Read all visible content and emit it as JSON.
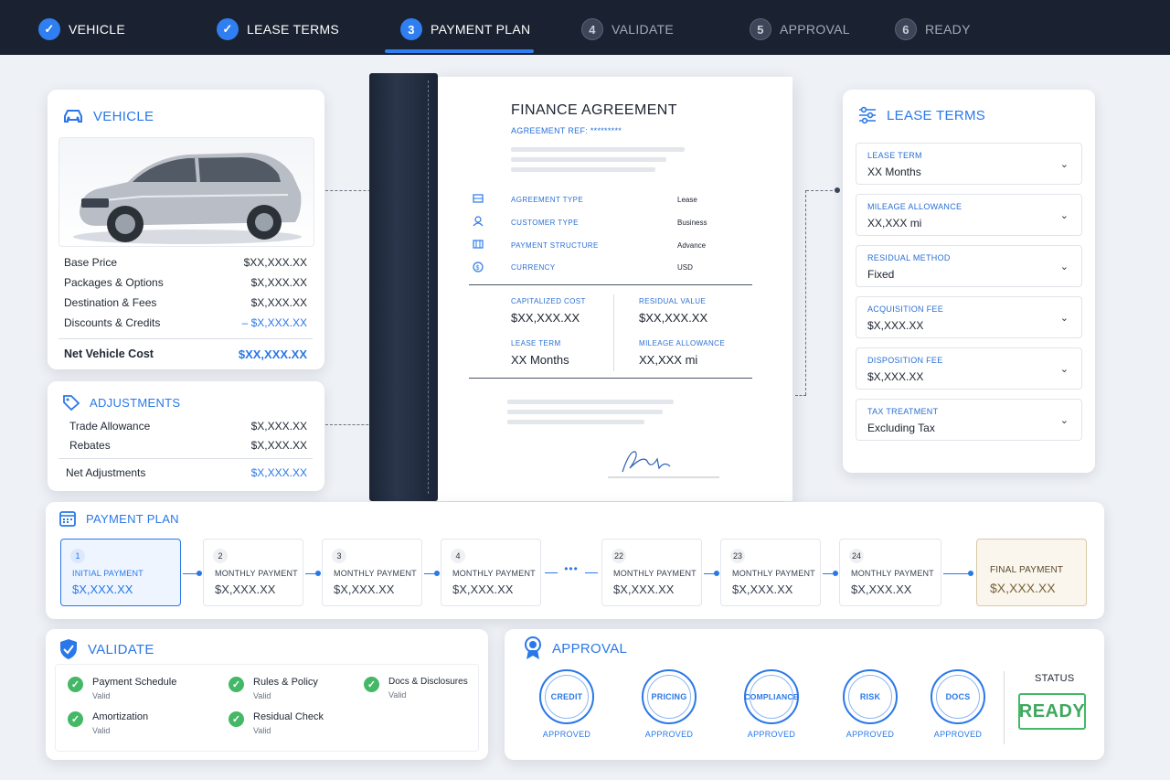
{
  "stepper": [
    {
      "num": "",
      "label": "VEHICLE",
      "state": "done"
    },
    {
      "num": "",
      "label": "LEASE TERMS",
      "state": "done"
    },
    {
      "num": "3",
      "label": "PAYMENT PLAN",
      "state": "active"
    },
    {
      "num": "4",
      "label": "VALIDATE",
      "state": "todo"
    },
    {
      "num": "5",
      "label": "APPROVAL",
      "state": "todo"
    },
    {
      "num": "6",
      "label": "READY",
      "state": "todo"
    }
  ],
  "vehicle": {
    "title": "VEHICLE",
    "rows": [
      {
        "label": "Base Price",
        "value": "$XX,XXX.XX"
      },
      {
        "label": "Packages & Options",
        "value": "$X,XXX.XX"
      },
      {
        "label": "Destination & Fees",
        "value": "$X,XXX.XX"
      },
      {
        "label": "Discounts & Credits",
        "value": "– $X,XXX.XX"
      }
    ],
    "net_label": "Net Vehicle Cost",
    "net_value": "$XX,XXX.XX"
  },
  "adjustments": {
    "title": "ADJUSTMENTS",
    "rows": [
      {
        "label": "Trade Allowance",
        "value": "$X,XXX.XX"
      },
      {
        "label": "Rebates",
        "value": "$X,XXX.XX"
      }
    ],
    "net_label": "Net Adjustments",
    "net_value": "$X,XXX.XX"
  },
  "document": {
    "title": "FINANCE AGREEMENT",
    "ref": "AGREEMENT REF: *********",
    "items": [
      {
        "label": "AGREEMENT TYPE",
        "value": "Lease"
      },
      {
        "label": "CUSTOMER TYPE",
        "value": "Business"
      },
      {
        "label": "PAYMENT STRUCTURE",
        "value": "Advance"
      },
      {
        "label": "CURRENCY",
        "value": "USD"
      }
    ],
    "grid": [
      {
        "label": "CAPITALIZED COST",
        "value": "$XX,XXX.XX"
      },
      {
        "label": "RESIDUAL VALUE",
        "value": "$XX,XXX.XX"
      },
      {
        "label": "LEASE TERM",
        "value": "XX Months"
      },
      {
        "label": "MILEAGE ALLOWANCE",
        "value": "XX,XXX mi"
      }
    ]
  },
  "lease_terms": {
    "title": "LEASE TERMS",
    "fields": [
      {
        "label": "LEASE TERM",
        "value": "XX Months"
      },
      {
        "label": "MILEAGE ALLOWANCE",
        "value": "XX,XXX mi"
      },
      {
        "label": "RESIDUAL METHOD",
        "value": "Fixed"
      },
      {
        "label": "ACQUISITION FEE",
        "value": "$X,XXX.XX"
      },
      {
        "label": "DISPOSITION FEE",
        "value": "$X,XXX.XX"
      },
      {
        "label": "TAX TREATMENT",
        "value": "Excluding Tax"
      }
    ]
  },
  "payment_plan": {
    "title": "PAYMENT PLAN",
    "payments": [
      {
        "num": "1",
        "label": "INITIAL PAYMENT",
        "value": "$X,XXX.XX"
      },
      {
        "num": "2",
        "label": "MONTHLY PAYMENT",
        "value": "$X,XXX.XX"
      },
      {
        "num": "3",
        "label": "MONTHLY PAYMENT",
        "value": "$X,XXX.XX"
      },
      {
        "num": "4",
        "label": "MONTHLY PAYMENT",
        "value": "$X,XXX.XX"
      },
      {
        "num": "22",
        "label": "MONTHLY PAYMENT",
        "value": "$X,XXX.XX"
      },
      {
        "num": "23",
        "label": "MONTHLY PAYMENT",
        "value": "$X,XXX.XX"
      },
      {
        "num": "24",
        "label": "MONTHLY PAYMENT",
        "value": "$X,XXX.XX"
      }
    ],
    "ellipsis": "•••",
    "final_label": "FINAL PAYMENT",
    "final_value": "$X,XXX.XX"
  },
  "validate": {
    "title": "VALIDATE",
    "items": [
      {
        "label": "Payment Schedule",
        "status": "Valid"
      },
      {
        "label": "Rules  &  Policy",
        "status": "Valid"
      },
      {
        "label": "Docs & Disclosures",
        "status": "Valid"
      },
      {
        "label": "Amortization",
        "status": "Valid"
      },
      {
        "label": "Residual Check",
        "status": "Valid"
      }
    ]
  },
  "approval": {
    "title": "APPROVAL",
    "badges": [
      {
        "label": "CREDIT",
        "status": "APPROVED"
      },
      {
        "label": "PRICING",
        "status": "APPROVED"
      },
      {
        "label": "COMPLIANCE",
        "status": "APPROVED"
      },
      {
        "label": "RISK",
        "status": "APPROVED"
      },
      {
        "label": "DOCS",
        "status": "APPROVED"
      }
    ],
    "status_label": "STATUS",
    "status_value": "READY"
  },
  "colors": {
    "accent": "#2a78e8",
    "header": "#1a2130",
    "success": "#44b866",
    "final": "#faf6ee"
  }
}
